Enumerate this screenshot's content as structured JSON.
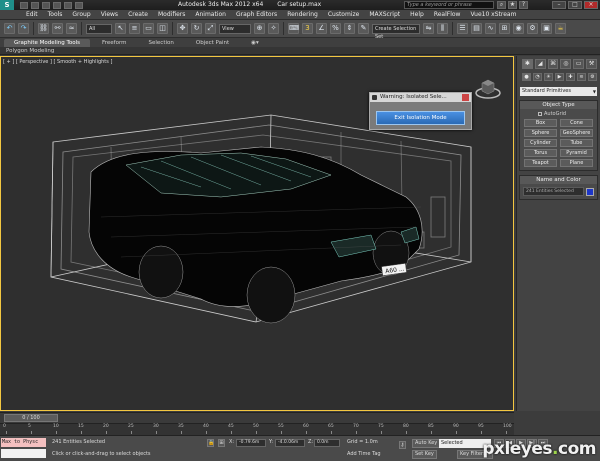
{
  "titlebar": {
    "app_title": "Autodesk 3ds Max 2012 x64",
    "file_name": "Car setup.max",
    "search_placeholder": "Type a keyword or phrase",
    "logo_glyph": "S"
  },
  "menu": {
    "items": [
      "Edit",
      "Tools",
      "Group",
      "Views",
      "Create",
      "Modifiers",
      "Animation",
      "Graph Editors",
      "Rendering",
      "Customize",
      "MAXScript",
      "Help",
      "RealFlow",
      "Vue10 xStream"
    ]
  },
  "toolbar": {
    "selection_filter": "All",
    "ref_coord": "View",
    "named_selection": "Create Selection Set"
  },
  "ribbon": {
    "tabs": [
      "Graphite Modeling Tools",
      "Freeform",
      "Selection",
      "Object Paint"
    ],
    "subtab": "Polygon Modeling"
  },
  "viewport": {
    "label": "[ + ] [ Perspective ] [ Smooth + Highlights ]"
  },
  "dialog": {
    "title": "Warning: Isolated Sele...",
    "exit_button": "Exit Isolation Mode"
  },
  "command_panel": {
    "category": "Standard Primitives",
    "object_type_title": "Object Type",
    "autogrid_label": "AutoGrid",
    "primitives": [
      "Box",
      "Cone",
      "Sphere",
      "GeoSphere",
      "Cylinder",
      "Tube",
      "Torus",
      "Pyramid",
      "Teapot",
      "Plane"
    ],
    "name_color_title": "Name and Color",
    "name_value": "241 Entities Selected",
    "swatch_color": "#1d36c9"
  },
  "timeline": {
    "frame_readout": "0 / 100",
    "ticks": [
      "0",
      "5",
      "10",
      "15",
      "20",
      "25",
      "30",
      "35",
      "40",
      "45",
      "50",
      "55",
      "60",
      "65",
      "70",
      "75",
      "80",
      "85",
      "90",
      "95",
      "100"
    ]
  },
  "status": {
    "maxscript_line1": "Max to Physc",
    "maxscript_line2": "",
    "selection_info": "241 Entities Selected",
    "prompt": "Click or click-and-drag to select objects",
    "x_label": "X:",
    "x_value": "-0.79.6m",
    "y_label": "Y:",
    "y_value": "-4.0.06m",
    "z_label": "Z:",
    "z_value": "0.0m",
    "grid": "Grid = 1.0m",
    "add_time_tag": "Add Time Tag",
    "auto_key": "Auto Key",
    "set_key": "Set Key",
    "key_mode": "Selected",
    "key_filters": "Key Filters..."
  },
  "watermark": {
    "text_main": "pxleyes",
    "text_dot": ".",
    "text_tld": "com"
  }
}
